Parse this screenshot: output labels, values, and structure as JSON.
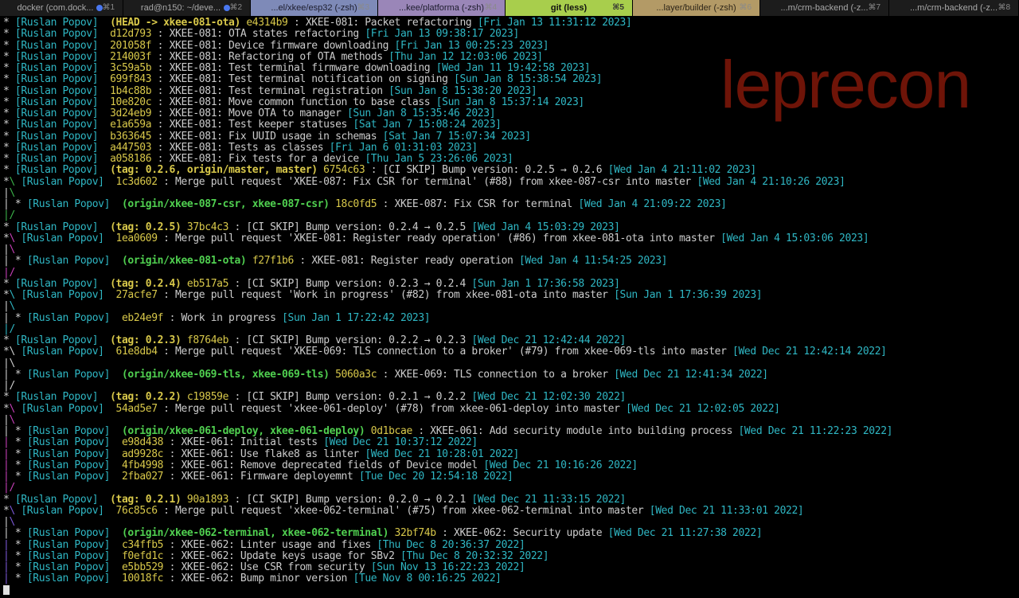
{
  "tabs": [
    {
      "title": "docker (com.dock...",
      "dot": true,
      "shortcut": "⌘1",
      "bg": "#1c1c1c",
      "fg": "#a8a8a8"
    },
    {
      "title": "rad@n150: ~/deve...",
      "dot": true,
      "shortcut": "⌘2",
      "bg": "#1c1c1c",
      "fg": "#a8a8a8"
    },
    {
      "title": "...el/xkee/esp32 (-zsh)",
      "dot": false,
      "shortcut": "⌘3",
      "bg": "#7e8ab8",
      "fg": "#1c1c2c"
    },
    {
      "title": "...kee/platforma (-zsh)",
      "dot": false,
      "shortcut": "⌘4",
      "bg": "#9a86b8",
      "fg": "#1c1c2c"
    },
    {
      "title": "git (less)",
      "dot": false,
      "shortcut": "⌘5",
      "bg": "#a8ce4c",
      "fg": "#111111",
      "active": true
    },
    {
      "title": "...layer/builder (-zsh)",
      "dot": false,
      "shortcut": "⌘6",
      "bg": "#b39a66",
      "fg": "#2c2418"
    },
    {
      "title": "...m/crm-backend (-z...",
      "dot": false,
      "shortcut": "⌘7",
      "bg": "#1c1c1c",
      "fg": "#a8a8a8"
    },
    {
      "title": "...m/crm-backend (-z...",
      "dot": false,
      "shortcut": "⌘8",
      "bg": "#1c1c1c",
      "fg": "#a8a8a8"
    }
  ],
  "watermark": "leprecon",
  "colors": {
    "background": "#000000",
    "author": "#2fb7c4",
    "hash": "#d8c84a",
    "ref": "#d8c84a",
    "branch_ref": "#50d050",
    "date": "#2fb7c4",
    "message": "#cccccc",
    "watermark": "#6e1408"
  },
  "log": [
    {
      "graph": [
        [
          "*",
          ""
        ],
        [
          " ",
          ""
        ]
      ],
      "author": "[Ruslan Popov]",
      "ref": "(HEAD -> xkee-081-ota)",
      "ref_style": "rf",
      "hash": "e4314b9",
      "message": "XKEE-081: Packet refactoring",
      "date": "[Fri Jan 13 11:31:12 2023]"
    },
    {
      "graph": [
        [
          "*",
          ""
        ],
        [
          " ",
          ""
        ]
      ],
      "author": "[Ruslan Popov]",
      "ref": "",
      "hash": "d12d793",
      "message": "XKEE-081: OTA states refactoring",
      "date": "[Fri Jan 13 09:38:17 2023]"
    },
    {
      "graph": [
        [
          "*",
          ""
        ],
        [
          " ",
          ""
        ]
      ],
      "author": "[Ruslan Popov]",
      "ref": "",
      "hash": "201058f",
      "message": "XKEE-081: Device firmware downloading",
      "date": "[Fri Jan 13 00:25:23 2023]"
    },
    {
      "graph": [
        [
          "*",
          ""
        ],
        [
          " ",
          ""
        ]
      ],
      "author": "[Ruslan Popov]",
      "ref": "",
      "hash": "214003f",
      "message": "XKEE-081: Refactoring of OTA methods",
      "date": "[Thu Jan 12 12:03:06 2023]"
    },
    {
      "graph": [
        [
          "*",
          ""
        ],
        [
          " ",
          ""
        ]
      ],
      "author": "[Ruslan Popov]",
      "ref": "",
      "hash": "3c59a5b",
      "message": "XKEE-081: Test terminal firmware downloading",
      "date": "[Wed Jan 11 19:42:58 2023]"
    },
    {
      "graph": [
        [
          "*",
          ""
        ],
        [
          " ",
          ""
        ]
      ],
      "author": "[Ruslan Popov]",
      "ref": "",
      "hash": "699f843",
      "message": "XKEE-081: Test terminal notification on signing",
      "date": "[Sun Jan 8 15:38:54 2023]"
    },
    {
      "graph": [
        [
          "*",
          ""
        ],
        [
          " ",
          ""
        ]
      ],
      "author": "[Ruslan Popov]",
      "ref": "",
      "hash": "1b4c88b",
      "message": "XKEE-081: Test terminal registration",
      "date": "[Sun Jan 8 15:38:20 2023]"
    },
    {
      "graph": [
        [
          "*",
          ""
        ],
        [
          " ",
          ""
        ]
      ],
      "author": "[Ruslan Popov]",
      "ref": "",
      "hash": "10e820c",
      "message": "XKEE-081: Move common function to base class",
      "date": "[Sun Jan 8 15:37:14 2023]"
    },
    {
      "graph": [
        [
          "*",
          ""
        ],
        [
          " ",
          ""
        ]
      ],
      "author": "[Ruslan Popov]",
      "ref": "",
      "hash": "3d24eb9",
      "message": "XKEE-081: Move OTA to manager",
      "date": "[Sun Jan 8 15:35:46 2023]"
    },
    {
      "graph": [
        [
          "*",
          ""
        ],
        [
          " ",
          ""
        ]
      ],
      "author": "[Ruslan Popov]",
      "ref": "",
      "hash": "e1a659a",
      "message": "XKEE-081: Test keeper statuses",
      "date": "[Sat Jan 7 15:08:24 2023]"
    },
    {
      "graph": [
        [
          "*",
          ""
        ],
        [
          " ",
          ""
        ]
      ],
      "author": "[Ruslan Popov]",
      "ref": "",
      "hash": "b363645",
      "message": "XKEE-081: Fix UUID usage in schemas",
      "date": "[Sat Jan 7 15:07:34 2023]"
    },
    {
      "graph": [
        [
          "*",
          ""
        ],
        [
          " ",
          ""
        ]
      ],
      "author": "[Ruslan Popov]",
      "ref": "",
      "hash": "a447503",
      "message": "XKEE-081: Tests as classes",
      "date": "[Fri Jan 6 01:31:03 2023]"
    },
    {
      "graph": [
        [
          "*",
          ""
        ],
        [
          " ",
          ""
        ]
      ],
      "author": "[Ruslan Popov]",
      "ref": "",
      "hash": "a058186",
      "message": "XKEE-081: Fix tests for a device",
      "date": "[Thu Jan 5 23:26:06 2023]"
    },
    {
      "graph": [
        [
          "*",
          ""
        ],
        [
          " ",
          ""
        ]
      ],
      "author": "[Ruslan Popov]",
      "ref": "(tag: 0.2.6, origin/master, master)",
      "ref_style": "rf",
      "hash": "6754c63",
      "message": "[CI SKIP] Bump version: 0.2.5 → 0.2.6",
      "date": "[Wed Jan 4 21:11:02 2023]"
    },
    {
      "graph": [
        [
          "*",
          ""
        ],
        [
          "\\",
          "ge"
        ],
        [
          " ",
          ""
        ]
      ],
      "author": "[Ruslan Popov]",
      "ref": "",
      "hash": "1c3d602",
      "message": "Merge pull request 'XKEE-087: Fix CSR for terminal' (#88) from xkee-087-csr into master",
      "date": "[Wed Jan 4 21:10:26 2023]"
    },
    {
      "graph": [
        [
          "|",
          ""
        ],
        [
          "\\",
          "ge"
        ]
      ]
    },
    {
      "graph": [
        [
          "|",
          ""
        ],
        [
          " ",
          ""
        ],
        [
          "*",
          ""
        ],
        [
          " ",
          ""
        ]
      ],
      "author": "[Ruslan Popov]",
      "ref": "(origin/xkee-087-csr, xkee-087-csr)",
      "ref_style": "rg",
      "hash": "18c0fd5",
      "message": "XKEE-087: Fix CSR for terminal",
      "date": "[Wed Jan 4 21:09:22 2023]"
    },
    {
      "graph": [
        [
          "|",
          "ge"
        ],
        [
          "/",
          "ge"
        ]
      ]
    },
    {
      "graph": [
        [
          "*",
          ""
        ],
        [
          " ",
          ""
        ]
      ],
      "author": "[Ruslan Popov]",
      "ref": "(tag: 0.2.5)",
      "ref_style": "rf",
      "hash": "37bc4c3",
      "message": "[CI SKIP] Bump version: 0.2.4 → 0.2.5",
      "date": "[Wed Jan 4 15:03:29 2023]"
    },
    {
      "graph": [
        [
          "*",
          ""
        ],
        [
          "\\",
          "gp"
        ],
        [
          " ",
          ""
        ]
      ],
      "author": "[Ruslan Popov]",
      "ref": "",
      "hash": "1ea0609",
      "message": "Merge pull request 'XKEE-081: Register ready operation' (#86) from xkee-081-ota into master",
      "date": "[Wed Jan 4 15:03:06 2023]"
    },
    {
      "graph": [
        [
          "|",
          ""
        ],
        [
          "\\",
          "gp"
        ]
      ]
    },
    {
      "graph": [
        [
          "|",
          ""
        ],
        [
          " ",
          ""
        ],
        [
          "*",
          ""
        ],
        [
          " ",
          ""
        ]
      ],
      "author": "[Ruslan Popov]",
      "ref": "(origin/xkee-081-ota)",
      "ref_style": "rg",
      "hash": "f27f1b6",
      "message": "XKEE-081: Register ready operation",
      "date": "[Wed Jan 4 11:54:25 2023]"
    },
    {
      "graph": [
        [
          "|",
          "gp"
        ],
        [
          "/",
          "gp"
        ]
      ]
    },
    {
      "graph": [
        [
          "*",
          ""
        ],
        [
          " ",
          ""
        ]
      ],
      "author": "[Ruslan Popov]",
      "ref": "(tag: 0.2.4)",
      "ref_style": "rf",
      "hash": "eb517a5",
      "message": "[CI SKIP] Bump version: 0.2.3 → 0.2.4",
      "date": "[Sun Jan 1 17:36:58 2023]"
    },
    {
      "graph": [
        [
          "*",
          ""
        ],
        [
          "\\",
          "gc"
        ],
        [
          " ",
          ""
        ]
      ],
      "author": "[Ruslan Popov]",
      "ref": "",
      "hash": "27acfe7",
      "message": "Merge pull request 'Work in progress' (#82) from xkee-081-ota into master",
      "date": "[Sun Jan 1 17:36:39 2023]"
    },
    {
      "graph": [
        [
          "|",
          ""
        ],
        [
          "\\",
          "gc"
        ]
      ]
    },
    {
      "graph": [
        [
          "|",
          ""
        ],
        [
          " ",
          ""
        ],
        [
          "*",
          ""
        ],
        [
          " ",
          ""
        ]
      ],
      "author": "[Ruslan Popov]",
      "ref": "",
      "hash": "eb24e9f",
      "message": "Work in progress",
      "date": "[Sun Jan 1 17:22:42 2023]"
    },
    {
      "graph": [
        [
          "|",
          "gc"
        ],
        [
          "/",
          "gc"
        ]
      ]
    },
    {
      "graph": [
        [
          "*",
          ""
        ],
        [
          " ",
          ""
        ]
      ],
      "author": "[Ruslan Popov]",
      "ref": "(tag: 0.2.3)",
      "ref_style": "rf",
      "hash": "f8764eb",
      "message": "[CI SKIP] Bump version: 0.2.2 → 0.2.3",
      "date": "[Wed Dec 21 12:42:44 2022]"
    },
    {
      "graph": [
        [
          "*",
          ""
        ],
        [
          "\\",
          "gw"
        ],
        [
          " ",
          ""
        ]
      ],
      "author": "[Ruslan Popov]",
      "ref": "",
      "hash": "61e8db4",
      "message": "Merge pull request 'XKEE-069: TLS connection to a broker' (#79) from xkee-069-tls into master",
      "date": "[Wed Dec 21 12:42:14 2022]"
    },
    {
      "graph": [
        [
          "|",
          ""
        ],
        [
          "\\",
          "gw"
        ]
      ]
    },
    {
      "graph": [
        [
          "|",
          ""
        ],
        [
          " ",
          ""
        ],
        [
          "*",
          ""
        ],
        [
          " ",
          ""
        ]
      ],
      "author": "[Ruslan Popov]",
      "ref": "(origin/xkee-069-tls, xkee-069-tls)",
      "ref_style": "rg",
      "hash": "5060a3c",
      "message": "XKEE-069: TLS connection to a broker",
      "date": "[Wed Dec 21 12:41:34 2022]"
    },
    {
      "graph": [
        [
          "|",
          "gw"
        ],
        [
          "/",
          "gw"
        ]
      ]
    },
    {
      "graph": [
        [
          "*",
          ""
        ],
        [
          " ",
          ""
        ]
      ],
      "author": "[Ruslan Popov]",
      "ref": "(tag: 0.2.2)",
      "ref_style": "rf",
      "hash": "c19859e",
      "message": "[CI SKIP] Bump version: 0.2.1 → 0.2.2",
      "date": "[Wed Dec 21 12:02:30 2022]"
    },
    {
      "graph": [
        [
          "*",
          ""
        ],
        [
          "\\",
          "gp"
        ],
        [
          " ",
          ""
        ]
      ],
      "author": "[Ruslan Popov]",
      "ref": "",
      "hash": "54ad5e7",
      "message": "Merge pull request 'xkee-061-deploy' (#78) from xkee-061-deploy into master",
      "date": "[Wed Dec 21 12:02:05 2022]"
    },
    {
      "graph": [
        [
          "|",
          ""
        ],
        [
          "\\",
          "gp"
        ]
      ]
    },
    {
      "graph": [
        [
          "|",
          ""
        ],
        [
          " ",
          ""
        ],
        [
          "*",
          ""
        ],
        [
          " ",
          ""
        ]
      ],
      "author": "[Ruslan Popov]",
      "ref": "(origin/xkee-061-deploy, xkee-061-deploy)",
      "ref_style": "rg",
      "hash": "0d1bcae",
      "message": "XKEE-061: Add security module into building process",
      "date": "[Wed Dec 21 11:22:23 2022]"
    },
    {
      "graph": [
        [
          "|",
          "gp"
        ],
        [
          " ",
          ""
        ],
        [
          "*",
          ""
        ],
        [
          " ",
          ""
        ]
      ],
      "author": "[Ruslan Popov]",
      "ref": "",
      "hash": "e98d438",
      "message": "XKEE-061: Initial tests",
      "date": "[Wed Dec 21 10:37:12 2022]"
    },
    {
      "graph": [
        [
          "|",
          "gp"
        ],
        [
          " ",
          ""
        ],
        [
          "*",
          ""
        ],
        [
          " ",
          ""
        ]
      ],
      "author": "[Ruslan Popov]",
      "ref": "",
      "hash": "ad9928c",
      "message": "XKEE-061: Use flake8 as linter",
      "date": "[Wed Dec 21 10:28:01 2022]"
    },
    {
      "graph": [
        [
          "|",
          "gp"
        ],
        [
          " ",
          ""
        ],
        [
          "*",
          ""
        ],
        [
          " ",
          ""
        ]
      ],
      "author": "[Ruslan Popov]",
      "ref": "",
      "hash": "4fb4998",
      "message": "XKEE-061: Remove deprecated fields of Device model",
      "date": "[Wed Dec 21 10:16:26 2022]"
    },
    {
      "graph": [
        [
          "|",
          "gp"
        ],
        [
          " ",
          ""
        ],
        [
          "*",
          ""
        ],
        [
          " ",
          ""
        ]
      ],
      "author": "[Ruslan Popov]",
      "ref": "",
      "hash": "2fba027",
      "message": "XKEE-061: Firmware deployemnt",
      "date": "[Tue Dec 20 12:54:18 2022]"
    },
    {
      "graph": [
        [
          "|",
          "gp"
        ],
        [
          "/",
          "gp"
        ]
      ]
    },
    {
      "graph": [
        [
          "*",
          ""
        ],
        [
          " ",
          ""
        ]
      ],
      "author": "[Ruslan Popov]",
      "ref": "(tag: 0.2.1)",
      "ref_style": "rf",
      "hash": "90a1893",
      "message": "[CI SKIP] Bump version: 0.2.0 → 0.2.1",
      "date": "[Wed Dec 21 11:33:15 2022]"
    },
    {
      "graph": [
        [
          "*",
          ""
        ],
        [
          "\\",
          "gd"
        ],
        [
          " ",
          ""
        ]
      ],
      "author": "[Ruslan Popov]",
      "ref": "",
      "hash": "76c85c6",
      "message": "Merge pull request 'xkee-062-terminal' (#75) from xkee-062-terminal into master",
      "date": "[Wed Dec 21 11:33:01 2022]"
    },
    {
      "graph": [
        [
          "|",
          ""
        ],
        [
          "\\",
          "gd"
        ]
      ]
    },
    {
      "graph": [
        [
          "|",
          ""
        ],
        [
          " ",
          ""
        ],
        [
          "*",
          ""
        ],
        [
          " ",
          ""
        ]
      ],
      "author": "[Ruslan Popov]",
      "ref": "(origin/xkee-062-terminal, xkee-062-terminal)",
      "ref_style": "rg",
      "hash": "32bf74b",
      "message": "XKEE-062: Security update",
      "date": "[Wed Dec 21 11:27:38 2022]"
    },
    {
      "graph": [
        [
          "|",
          "gd"
        ],
        [
          " ",
          ""
        ],
        [
          "*",
          ""
        ],
        [
          " ",
          ""
        ]
      ],
      "author": "[Ruslan Popov]",
      "ref": "",
      "hash": "c34ffb5",
      "message": "XKEE-062: Linter usage and fixes",
      "date": "[Thu Dec 8 20:36:37 2022]"
    },
    {
      "graph": [
        [
          "|",
          "gd"
        ],
        [
          " ",
          ""
        ],
        [
          "*",
          ""
        ],
        [
          " ",
          ""
        ]
      ],
      "author": "[Ruslan Popov]",
      "ref": "",
      "hash": "f0efd1c",
      "message": "XKEE-062: Update keys usage for SBv2",
      "date": "[Thu Dec 8 20:32:32 2022]"
    },
    {
      "graph": [
        [
          "|",
          "gd"
        ],
        [
          " ",
          ""
        ],
        [
          "*",
          ""
        ],
        [
          " ",
          ""
        ]
      ],
      "author": "[Ruslan Popov]",
      "ref": "",
      "hash": "e5bb529",
      "message": "XKEE-062: Use CSR from security",
      "date": "[Sun Nov 13 16:22:23 2022]"
    },
    {
      "graph": [
        [
          "|",
          "gd"
        ],
        [
          " ",
          ""
        ],
        [
          "*",
          ""
        ],
        [
          " ",
          ""
        ]
      ],
      "author": "[Ruslan Popov]",
      "ref": "",
      "hash": "10018fc",
      "message": "XKEE-062: Bump minor version",
      "date": "[Tue Nov 8 00:16:25 2022]"
    }
  ]
}
